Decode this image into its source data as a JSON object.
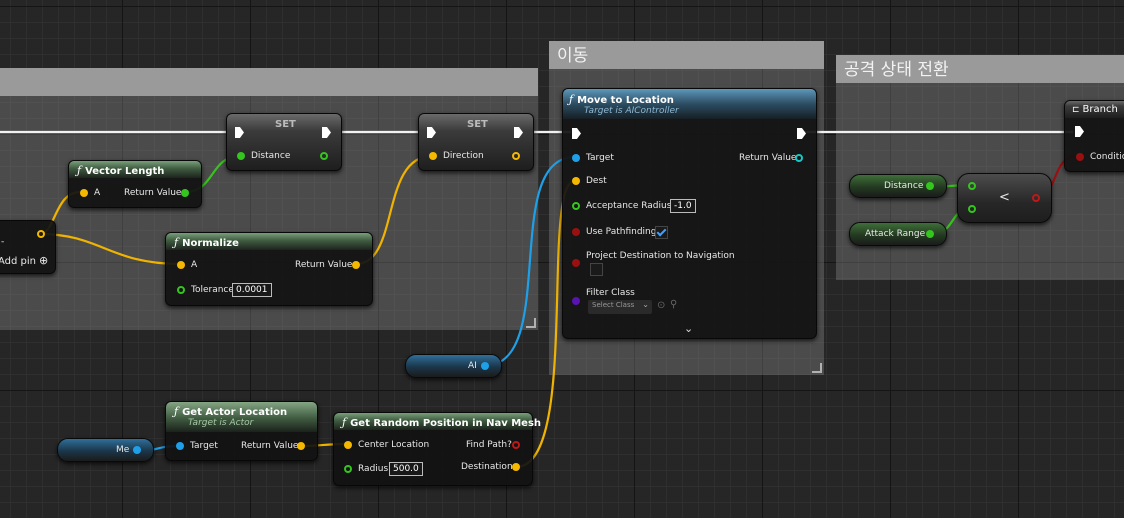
{
  "comments": {
    "move": "이동",
    "attack": "공격 상태 전환"
  },
  "set_nodes": {
    "set_distance": {
      "title": "SET",
      "pin_label": "Distance"
    },
    "set_direction": {
      "title": "SET",
      "pin_label": "Direction"
    }
  },
  "vector_length": {
    "title": "Vector Length",
    "in_a": "A",
    "out": "Return Value"
  },
  "normalize": {
    "title": "Normalize",
    "in_a": "A",
    "tolerance_label": "Tolerance",
    "tolerance_value": "0.0001",
    "out": "Return Value"
  },
  "make_node": {
    "add_pin": "Add pin"
  },
  "move_to_location": {
    "title": "Move to Location",
    "subtitle": "Target is AIController",
    "target": "Target",
    "return_value": "Return Value",
    "dest": "Dest",
    "acceptance_radius_label": "Acceptance Radius",
    "acceptance_radius_value": "-1.0",
    "use_pathfinding": "Use Pathfinding",
    "use_pathfinding_checked": true,
    "project_dest": "Project Destination to Navigation",
    "project_dest_checked": false,
    "filter_class": "Filter Class",
    "filter_class_select": "Select Class"
  },
  "ai_var": "AI",
  "me_var": "Me",
  "get_actor_location": {
    "title": "Get Actor Location",
    "subtitle": "Target is Actor",
    "target": "Target",
    "out": "Return Value"
  },
  "random_nav": {
    "title": "Get Random Position in Nav Mesh",
    "center": "Center Location",
    "radius_label": "Radius",
    "radius_value": "500.0",
    "find_path": "Find Path?",
    "destination": "Destination"
  },
  "distance_var": "Distance",
  "attack_range_var": "Attack Range",
  "compare": {
    "op": "<"
  },
  "branch": {
    "title": "Branch",
    "condition": "Condition"
  }
}
